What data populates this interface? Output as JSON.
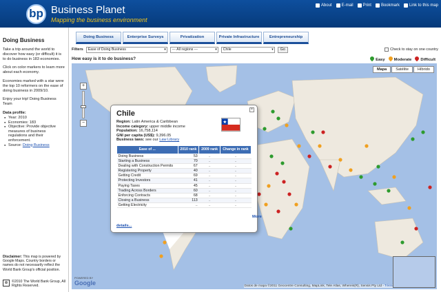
{
  "header": {
    "logo_text": "bp",
    "brand": "Business Planet",
    "tagline": "Mapping the business environment",
    "links": [
      "About",
      "E-mail",
      "Print",
      "Bookmark",
      "Link to this map"
    ]
  },
  "sidebar": {
    "title": "Doing Business",
    "paragraphs": [
      "Take a trip around the world to discover how easy (or difficult) it is to do business in 183 economies.",
      "Click on color markers to learn more about each economy.",
      "Economies marked with a star were the top 10 reformers on the ease of doing business in 2009/10.",
      "Enjoy your trip! Doing Business Team"
    ],
    "profile_title": "Data profile:",
    "profile_items": [
      "Year: 2010",
      "Economies: 183",
      "Objective: Provide objective measures of business regulations and their enforcement."
    ],
    "source_prefix": "Source: ",
    "source_link": "Doing Business",
    "disclaimer_label": "Disclaimer:",
    "disclaimer_text": " This map is powered by Google Maps. Country borders or names do not necessarily reflect the World Bank Group's official position.",
    "copyright": "©2010 The World Bank Group, All Rights Reserved."
  },
  "tabs": [
    {
      "label": "Doing Business"
    },
    {
      "label": "Enterprise Surveys"
    },
    {
      "label": "Privatization"
    },
    {
      "label": "Private Infrastructure"
    },
    {
      "label": "Entrepreneurship"
    }
  ],
  "filters": {
    "label": "Filters",
    "indicator": "Ease of Doing Business",
    "region": "--- All regions ---",
    "country": "Chile",
    "go_label": "Go",
    "checkbox_label": "Check to stay on one country"
  },
  "map": {
    "question": "How easy is it to do business?",
    "legend": {
      "easy": "Easy",
      "moderate": "Moderate",
      "difficult": "Difficult",
      "easy_color": "#2e9b2e",
      "moderate_color": "#f0a020",
      "difficult_color": "#cc2222"
    },
    "map_types": [
      "Mapa",
      "Satélite",
      "Híbrido"
    ],
    "attribution": "Datos de mapa ©2011 Geocentre Consulting, MapLink, Tele Atlas, Whereis(R), Sensis Pty Ltd -",
    "attribution_link": "Términos de uso",
    "powered": "POWERED BY",
    "google": "Google",
    "more_label": "More"
  },
  "popup": {
    "country": "Chile",
    "region_label": "Region:",
    "region": "Latin America & Caribbean",
    "income_label": "Income category:",
    "income": "upper middle income",
    "population_label": "Population:",
    "population": "16,758,114",
    "gni_label": "GNI per capita (US$):",
    "gni": "9,396.05",
    "laws_label": "Business laws:",
    "laws_prefix": "see our",
    "laws_link": "Law Library",
    "columns": [
      "Ease of ...",
      "2010 rank",
      "2009 rank",
      "Change in rank"
    ],
    "rows": [
      {
        "name": "Doing Business",
        "rank2010": "53",
        "rank2009": "..",
        "change": ".."
      },
      {
        "name": "Starting a Business",
        "rank2010": "70",
        "rank2009": "..",
        "change": ".."
      },
      {
        "name": "Dealing with Construction Permits",
        "rank2010": "67",
        "rank2009": "..",
        "change": ".."
      },
      {
        "name": "Registering Property",
        "rank2010": "40",
        "rank2009": "..",
        "change": ".."
      },
      {
        "name": "Getting Credit",
        "rank2010": "69",
        "rank2009": "..",
        "change": ".."
      },
      {
        "name": "Protecting Investors",
        "rank2010": "41",
        "rank2009": "..",
        "change": ".."
      },
      {
        "name": "Paying Taxes",
        "rank2010": "45",
        "rank2009": "..",
        "change": ".."
      },
      {
        "name": "Trading Across Borders",
        "rank2010": "60",
        "rank2009": "..",
        "change": ".."
      },
      {
        "name": "Enforcing Contracts",
        "rank2010": "68",
        "rank2009": "..",
        "change": ".."
      },
      {
        "name": "Closing a Business",
        "rank2010": "113",
        "rank2009": "..",
        "change": ".."
      },
      {
        "name": "Getting Electricity",
        "rank2010": "..",
        "rank2009": "..",
        "change": ".."
      }
    ],
    "details_label": "details..."
  }
}
